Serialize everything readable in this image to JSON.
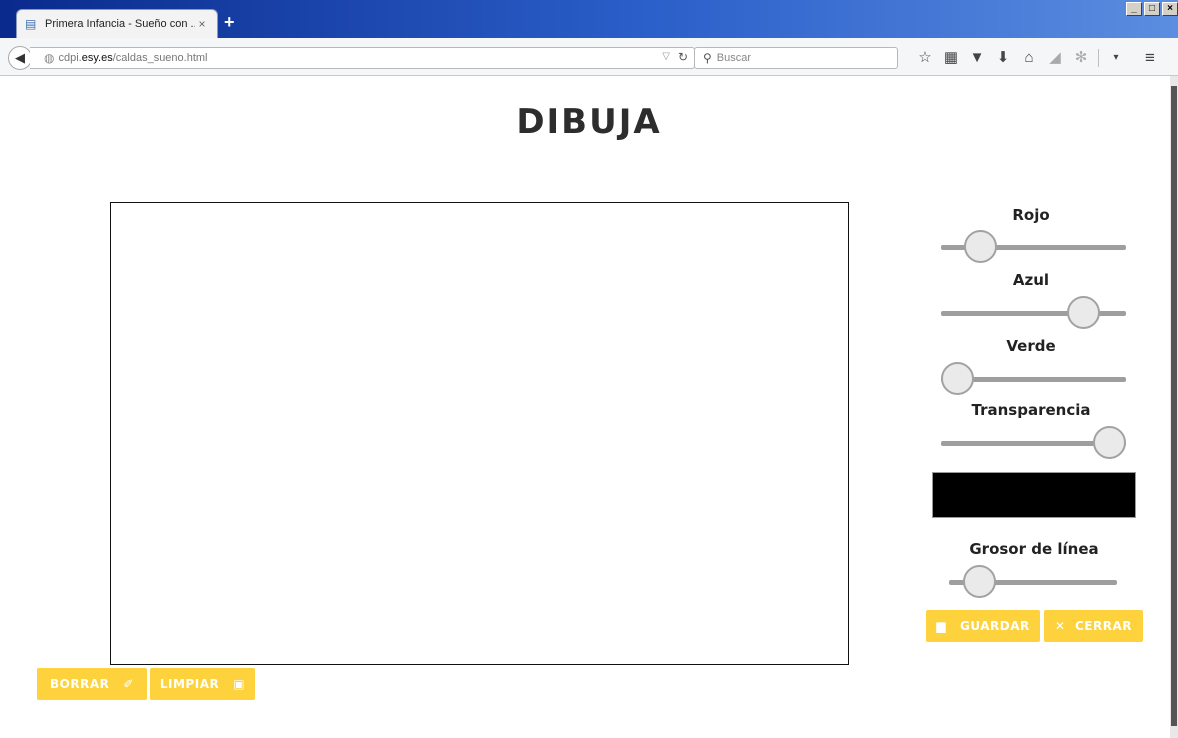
{
  "browser": {
    "tab_title": "Primera Infancia - Sueño con ...",
    "tab_close": "×",
    "new_tab": "+",
    "url_dim": "cdpi.",
    "url_host": "esy.es",
    "url_path": "/caldas_sueno.html",
    "search_placeholder": "Buscar",
    "window_buttons": [
      "_",
      "□",
      "×"
    ]
  },
  "page": {
    "title": "DIBUJA"
  },
  "controls": {
    "red": {
      "label": "Rojo",
      "value": 0.15
    },
    "blue": {
      "label": "Azul",
      "value": 0.83
    },
    "green": {
      "label": "Verde",
      "value": 0.0
    },
    "alpha": {
      "label": "Transparencia",
      "value": 1.0
    },
    "preview_color": "#000000",
    "line_width": {
      "label": "Grosor de línea",
      "value": 0.1
    }
  },
  "buttons": {
    "save": "GUARDAR",
    "close": "CERRAR",
    "erase": "BORRAR",
    "clear": "LIMPIAR"
  },
  "colors": {
    "accent": "#fdd23d"
  }
}
